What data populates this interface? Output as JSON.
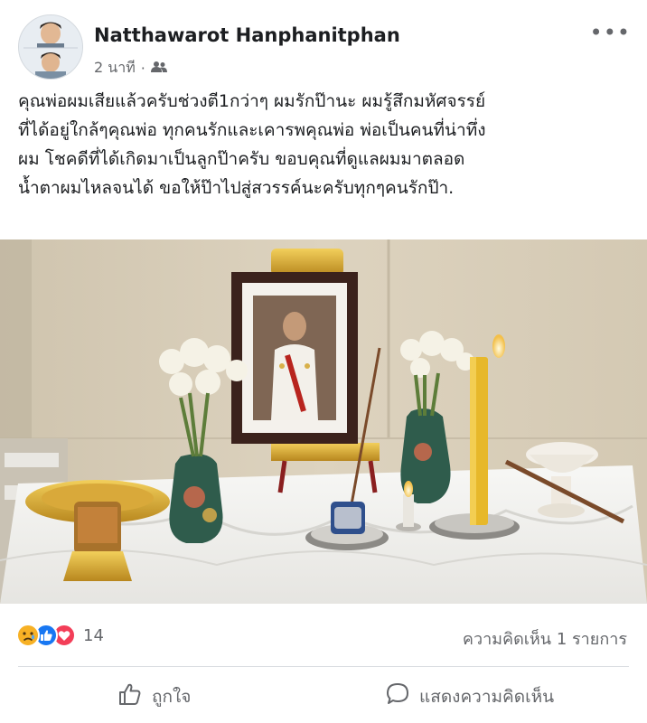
{
  "post": {
    "author": "Natthawarot Hanphanitphan",
    "time": "2 นาที",
    "separator": "·",
    "audience_icon": "friends-icon",
    "more_label": "•••",
    "text_lines": [
      "คุณพ่อผมเสียแล้วครับช่วงตี1กว่าๆ ผมรักป๊านะ ผมรู้สึกมหัศจรรย์",
      "ที่ได้อยู่ใกล้ๆคุณพ่อ ทุกคนรักและเคารพคุณพ่อ พ่อเป็นคนที่น่าทึ่ง",
      "ผม โชคดีที่ได้เกิดมาเป็นลูกป๊าครับ ขอบคุณที่ดูแลผมมาตลอด",
      "น้ำตาผมไหลจนได้ ขอให้ป๊าไปสู่สวรรค์นะครับทุกๆคนรักป๊า."
    ]
  },
  "reactions": {
    "icons": [
      "sad-icon",
      "like-icon",
      "love-icon"
    ],
    "count": "14",
    "comments": "ความคิดเห็น 1 รายการ"
  },
  "actions": {
    "like_label": "ถูกใจ",
    "comment_label": "แสดงความคิดเห็น"
  },
  "colors": {
    "like_blue": "#1877f2",
    "love_red": "#f33e58",
    "sad_yellow": "#f7b125",
    "muted_text": "#65676b"
  }
}
